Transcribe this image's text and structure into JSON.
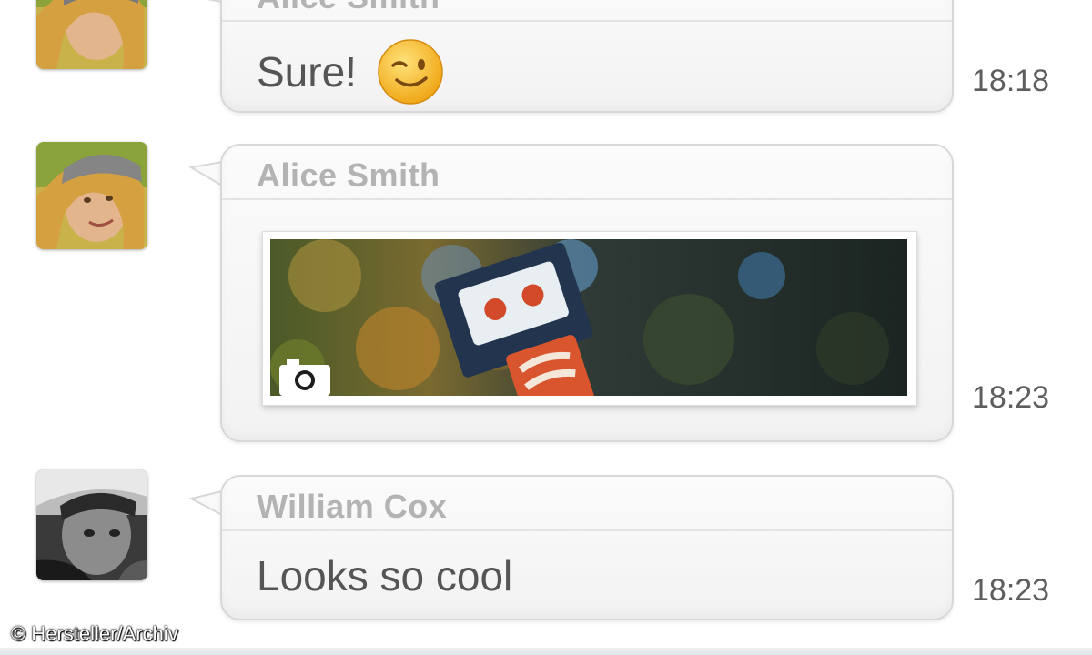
{
  "messages": [
    {
      "sender": "Alice Smith",
      "text": "Sure!",
      "emoji": "winking-face-icon",
      "time": "18:18"
    },
    {
      "sender": "Alice Smith",
      "attachment": "photo",
      "attachment_icon": "camera-icon",
      "time": "18:23"
    },
    {
      "sender": "William Cox",
      "text": "Looks so cool",
      "time": "18:23"
    }
  ],
  "credit": "© Hersteller/Archiv",
  "colors": {
    "bubble_border": "#d8d8d8",
    "sender_text": "#b3b3b3",
    "message_text": "#555555",
    "timestamp": "#5e5e5e"
  }
}
